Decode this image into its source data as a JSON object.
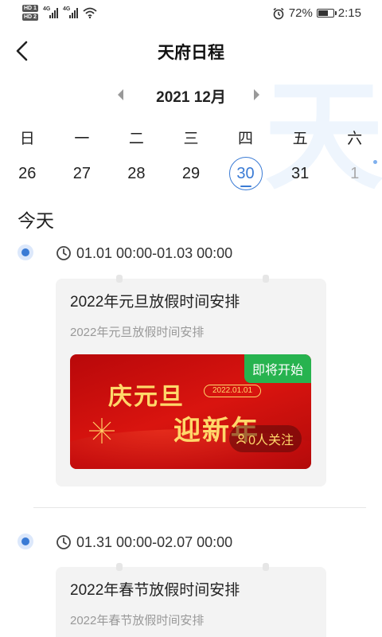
{
  "status_bar": {
    "hd_top": "HD 1",
    "hd_bottom": "HD 2",
    "net1": "4G",
    "net2": "4G",
    "battery_percent": "72%",
    "battery_level": 0.72,
    "time": "2:15",
    "icons": [
      "hd-icon",
      "signal-icon",
      "wifi-icon",
      "alarm-icon",
      "battery-icon"
    ]
  },
  "header": {
    "back_icon": "back-arrow-icon",
    "title": "天府日程"
  },
  "watermark": {
    "glyph": "天"
  },
  "calendar": {
    "month_label": "2021 12月",
    "prev_icon": "triangle-left-icon",
    "next_icon": "triangle-right-icon",
    "weekdays": [
      "日",
      "一",
      "二",
      "三",
      "四",
      "五",
      "六"
    ],
    "dates": [
      "26",
      "27",
      "28",
      "29",
      "30",
      "31",
      "1"
    ],
    "today_index": 4,
    "accent_color": "#3a7bd5"
  },
  "section": {
    "today_label": "今天"
  },
  "events": [
    {
      "time_range": "01.01 00:00-01.03 00:00",
      "title": "2022年元旦放假时间安排",
      "subtitle": "2022年元旦放假时间安排",
      "banner": {
        "headline1": "庆元旦",
        "headline2": "迎新年",
        "date": "2022.01.01",
        "status_badge": "即将开始",
        "followers": "0人关注",
        "status_color": "#27b34f",
        "bg_color": "#c8100e"
      }
    },
    {
      "time_range": "01.31 00:00-02.07 00:00",
      "title": "2022年春节放假时间安排",
      "subtitle": "2022年春节放假时间安排"
    }
  ]
}
